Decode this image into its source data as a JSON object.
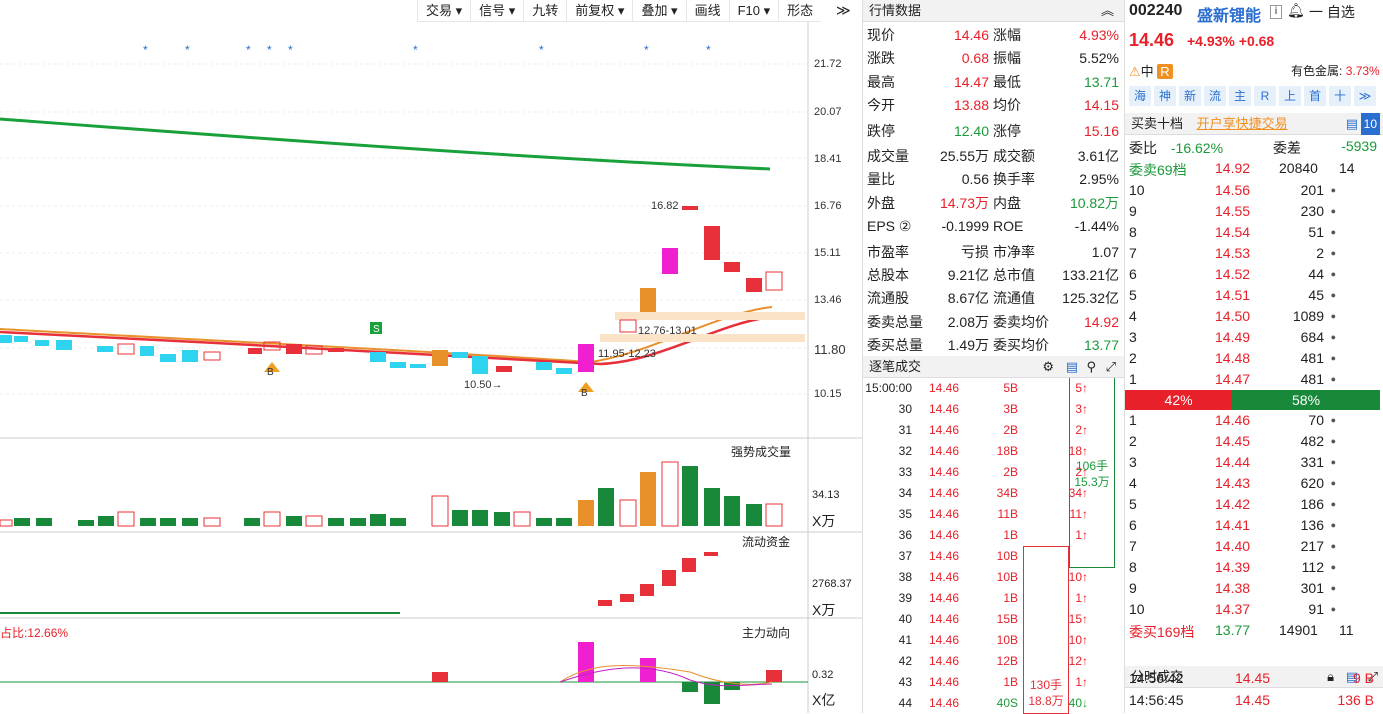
{
  "toolbar": [
    "交易 ▾",
    "信号 ▾",
    "九转",
    "前复权 ▾",
    "叠加 ▾",
    "画线",
    "F10 ▾",
    "形态"
  ],
  "chart": {
    "price_axis": [
      "21.72",
      "20.07",
      "18.41",
      "16.76",
      "15.11",
      "13.46",
      "11.80",
      "10.15"
    ],
    "annotations": {
      "high": "16.82",
      "band1": "12.76-13.01",
      "band2": "11.95-12.23",
      "low": "10.50"
    },
    "volume": {
      "title": "强势成交量",
      "tick": "34.13",
      "unit": "X万"
    },
    "flow": {
      "title": "流动资金",
      "tick": "2768.37",
      "unit": "X万"
    },
    "main": {
      "title": "主力动向",
      "tick": "0.32",
      "unit": "X亿",
      "ratio": "占比:12.66%"
    }
  },
  "quote": {
    "title": "行情数据",
    "rows": [
      {
        "k1": "现价",
        "v1": "14.46",
        "c1": "red",
        "k2": "涨幅",
        "v2": "4.93%",
        "c2": "red"
      },
      {
        "k1": "涨跌",
        "v1": "0.68",
        "c1": "red",
        "k2": "振幅",
        "v2": "5.52%",
        "c2": "black"
      },
      {
        "k1": "最高",
        "v1": "14.47",
        "c1": "red",
        "k2": "最低",
        "v2": "13.71",
        "c2": "green"
      },
      {
        "k1": "今开",
        "v1": "13.88",
        "c1": "red",
        "k2": "均价",
        "v2": "14.15",
        "c2": "red"
      },
      {
        "k1": "跌停",
        "v1": "12.40",
        "c1": "green",
        "k2": "涨停",
        "v2": "15.16",
        "c2": "red"
      },
      {
        "k1": "成交量",
        "v1": "25.55万",
        "c1": "black",
        "k2": "成交额",
        "v2": "3.61亿",
        "c2": "black"
      },
      {
        "k1": "量比",
        "v1": "0.56",
        "c1": "black",
        "k2": "换手率",
        "v2": "2.95%",
        "c2": "black"
      },
      {
        "k1": "外盘",
        "v1": "14.73万",
        "c1": "red",
        "k2": "内盘",
        "v2": "10.82万",
        "c2": "green"
      },
      {
        "k1": "EPS ②",
        "v1": "-0.1999",
        "c1": "black",
        "k2": "ROE",
        "v2": "-1.44%",
        "c2": "black"
      },
      {
        "k1": "市盈率",
        "v1": "亏损",
        "c1": "black",
        "k2": "市净率",
        "v2": "1.07",
        "c2": "black"
      },
      {
        "k1": "总股本",
        "v1": "9.21亿",
        "c1": "black",
        "k2": "总市值",
        "v2": "133.21亿",
        "c2": "black"
      },
      {
        "k1": "流通股",
        "v1": "8.67亿",
        "c1": "black",
        "k2": "流通值",
        "v2": "125.32亿",
        "c2": "black"
      },
      {
        "k1": "委卖总量",
        "v1": "2.08万",
        "c1": "black",
        "k2": "委卖均价",
        "v2": "14.92",
        "c2": "red"
      },
      {
        "k1": "委买总量",
        "v1": "1.49万",
        "c1": "black",
        "k2": "委买均价",
        "v2": "13.77",
        "c2": "green"
      }
    ]
  },
  "ticks": {
    "title": "逐笔成交",
    "rows": [
      {
        "t": "15:00:00",
        "p": "14.46",
        "v": "5B",
        "n": "5↑"
      },
      {
        "t": "30",
        "p": "14.46",
        "v": "3B",
        "n": "3↑"
      },
      {
        "t": "31",
        "p": "14.46",
        "v": "2B",
        "n": "2↑"
      },
      {
        "t": "32",
        "p": "14.46",
        "v": "18B",
        "n": "18↑"
      },
      {
        "t": "33",
        "p": "14.46",
        "v": "2B",
        "n": "2↑"
      },
      {
        "t": "34",
        "p": "14.46",
        "v": "34B",
        "n": "34↑"
      },
      {
        "t": "35",
        "p": "14.46",
        "v": "11B",
        "n": "11↑"
      },
      {
        "t": "36",
        "p": "14.46",
        "v": "1B",
        "n": "1↑"
      },
      {
        "t": "37",
        "p": "14.46",
        "v": "10B",
        "n": ""
      },
      {
        "t": "38",
        "p": "14.46",
        "v": "10B",
        "n": "10↑"
      },
      {
        "t": "39",
        "p": "14.46",
        "v": "1B",
        "n": "1↑"
      },
      {
        "t": "40",
        "p": "14.46",
        "v": "15B",
        "n": "15↑"
      },
      {
        "t": "41",
        "p": "14.46",
        "v": "10B",
        "n": "10↑"
      },
      {
        "t": "42",
        "p": "14.46",
        "v": "12B",
        "n": "12↑"
      },
      {
        "t": "43",
        "p": "14.46",
        "v": "1B",
        "n": "1↑"
      },
      {
        "t": "44",
        "p": "14.46",
        "v": "40S",
        "n": "40↓"
      }
    ],
    "block1": "106手\n15.3万",
    "block2": "130手\n18.8万"
  },
  "header": {
    "code": "002240",
    "name": "盛新锂能",
    "price": "14.46",
    "change": "+4.93% +0.68",
    "add": "一 自选",
    "risk": "中",
    "r": "R",
    "sector": "有色金属:",
    "sector_pct": "3.73%"
  },
  "buttons": [
    "海",
    "神",
    "新",
    "流",
    "主",
    "R",
    "上",
    "首",
    "十",
    "≫"
  ],
  "book": {
    "title": "买卖十档",
    "promo": "开户享快捷交易",
    "weibi_k": "委比",
    "weibi": "-16.62%",
    "weicha_k": "委差",
    "weicha": "-5939",
    "sell_total": "委卖69档",
    "sell_total_p": "14.92",
    "sell_total_v": "20840",
    "sell_total_n": "14",
    "asks": [
      {
        "l": "10",
        "p": "14.56",
        "v": "201"
      },
      {
        "l": "9",
        "p": "14.55",
        "v": "230"
      },
      {
        "l": "8",
        "p": "14.54",
        "v": "51"
      },
      {
        "l": "7",
        "p": "14.53",
        "v": "2"
      },
      {
        "l": "6",
        "p": "14.52",
        "v": "44"
      },
      {
        "l": "5",
        "p": "14.51",
        "v": "45"
      },
      {
        "l": "4",
        "p": "14.50",
        "v": "1089"
      },
      {
        "l": "3",
        "p": "14.49",
        "v": "684"
      },
      {
        "l": "2",
        "p": "14.48",
        "v": "481"
      },
      {
        "l": "1",
        "p": "14.47",
        "v": "481"
      }
    ],
    "sell_pct": "42%",
    "buy_pct": "58%",
    "bids": [
      {
        "l": "1",
        "p": "14.46",
        "v": "70"
      },
      {
        "l": "2",
        "p": "14.45",
        "v": "482"
      },
      {
        "l": "3",
        "p": "14.44",
        "v": "331"
      },
      {
        "l": "4",
        "p": "14.43",
        "v": "620"
      },
      {
        "l": "5",
        "p": "14.42",
        "v": "186"
      },
      {
        "l": "6",
        "p": "14.41",
        "v": "136"
      },
      {
        "l": "7",
        "p": "14.40",
        "v": "217"
      },
      {
        "l": "8",
        "p": "14.39",
        "v": "112"
      },
      {
        "l": "9",
        "p": "14.38",
        "v": "301"
      },
      {
        "l": "10",
        "p": "14.37",
        "v": "91"
      }
    ],
    "buy_total": "委买169档",
    "buy_total_p": "13.77",
    "buy_total_v": "14901",
    "buy_total_n": "11"
  },
  "timesales": {
    "title": "分时成交",
    "rows": [
      {
        "t": "14:56:42",
        "p": "14.45",
        "v": "9 B"
      },
      {
        "t": "14:56:45",
        "p": "14.45",
        "v": "136 B"
      }
    ]
  }
}
